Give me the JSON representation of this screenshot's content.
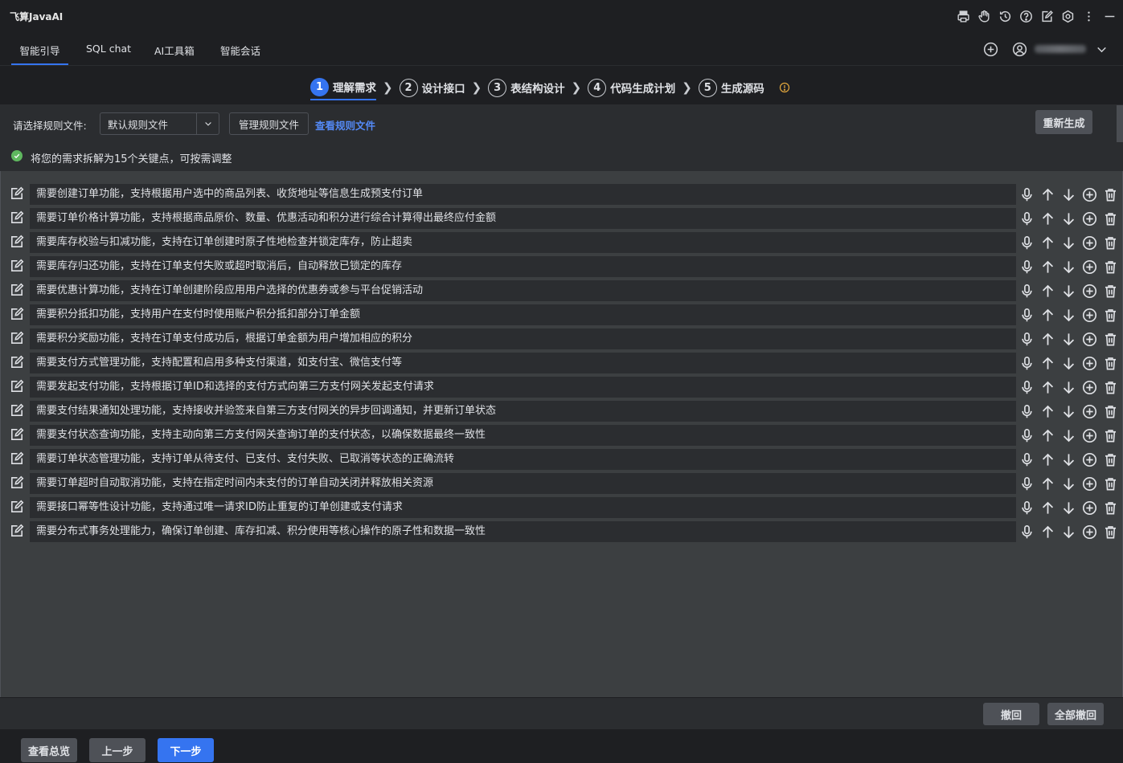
{
  "app": {
    "title": "飞算JavaAI"
  },
  "title_icons": [
    "print-icon",
    "hand-icon",
    "history-icon",
    "help-icon",
    "edit-note-icon",
    "settings-icon",
    "more-icon",
    "minimize-icon"
  ],
  "tabs": [
    {
      "label": "智能引导",
      "active": true
    },
    {
      "label": "SQL chat",
      "active": false
    },
    {
      "label": "AI工具箱",
      "active": false
    },
    {
      "label": "智能会话",
      "active": false
    }
  ],
  "steps": [
    {
      "num": "1",
      "label": "理解需求",
      "active": true
    },
    {
      "num": "2",
      "label": "设计接口",
      "active": false
    },
    {
      "num": "3",
      "label": "表结构设计",
      "active": false
    },
    {
      "num": "4",
      "label": "代码生成计划",
      "active": false
    },
    {
      "num": "5",
      "label": "生成源码",
      "active": false
    }
  ],
  "rules": {
    "label": "请选择规则文件:",
    "selected": "默认规则文件",
    "manage_label": "管理规则文件",
    "view_label": "查看规则文件",
    "regen_label": "重新生成"
  },
  "message": "将您的需求拆解为15个关键点，可按需调整",
  "items": [
    "需要创建订单功能，支持根据用户选中的商品列表、收货地址等信息生成预支付订单",
    "需要订单价格计算功能，支持根据商品原价、数量、优惠活动和积分进行综合计算得出最终应付金额",
    "需要库存校验与扣减功能，支持在订单创建时原子性地检查并锁定库存，防止超卖",
    "需要库存归还功能，支持在订单支付失败或超时取消后，自动释放已锁定的库存",
    "需要优惠计算功能，支持在订单创建阶段应用用户选择的优惠券或参与平台促销活动",
    "需要积分抵扣功能，支持用户在支付时使用账户积分抵扣部分订单金额",
    "需要积分奖励功能，支持在订单支付成功后，根据订单金额为用户增加相应的积分",
    "需要支付方式管理功能，支持配置和启用多种支付渠道，如支付宝、微信支付等",
    "需要发起支付功能，支持根据订单ID和选择的支付方式向第三方支付网关发起支付请求",
    "需要支付结果通知处理功能，支持接收并验签来自第三方支付网关的异步回调通知，并更新订单状态",
    "需要支付状态查询功能，支持主动向第三方支付网关查询订单的支付状态，以确保数据最终一致性",
    "需要订单状态管理功能，支持订单从待支付、已支付、支付失败、已取消等状态的正确流转",
    "需要订单超时自动取消功能，支持在指定时间内未支付的订单自动关闭并释放相关资源",
    "需要接口幂等性设计功能，支持通过唯一请求ID防止重复的订单创建或支付请求",
    "需要分布式事务处理能力，确保订单创建、库存扣减、积分使用等核心操作的原子性和数据一致性"
  ],
  "undo": {
    "undo_label": "撤回",
    "undo_all_label": "全部撤回"
  },
  "footer": {
    "overview_label": "查看总览",
    "prev_label": "上一步",
    "next_label": "下一步"
  },
  "colors": {
    "accent": "#3574f0",
    "success": "#5fb85f",
    "warning": "#e0a53c",
    "link": "#548af7"
  }
}
